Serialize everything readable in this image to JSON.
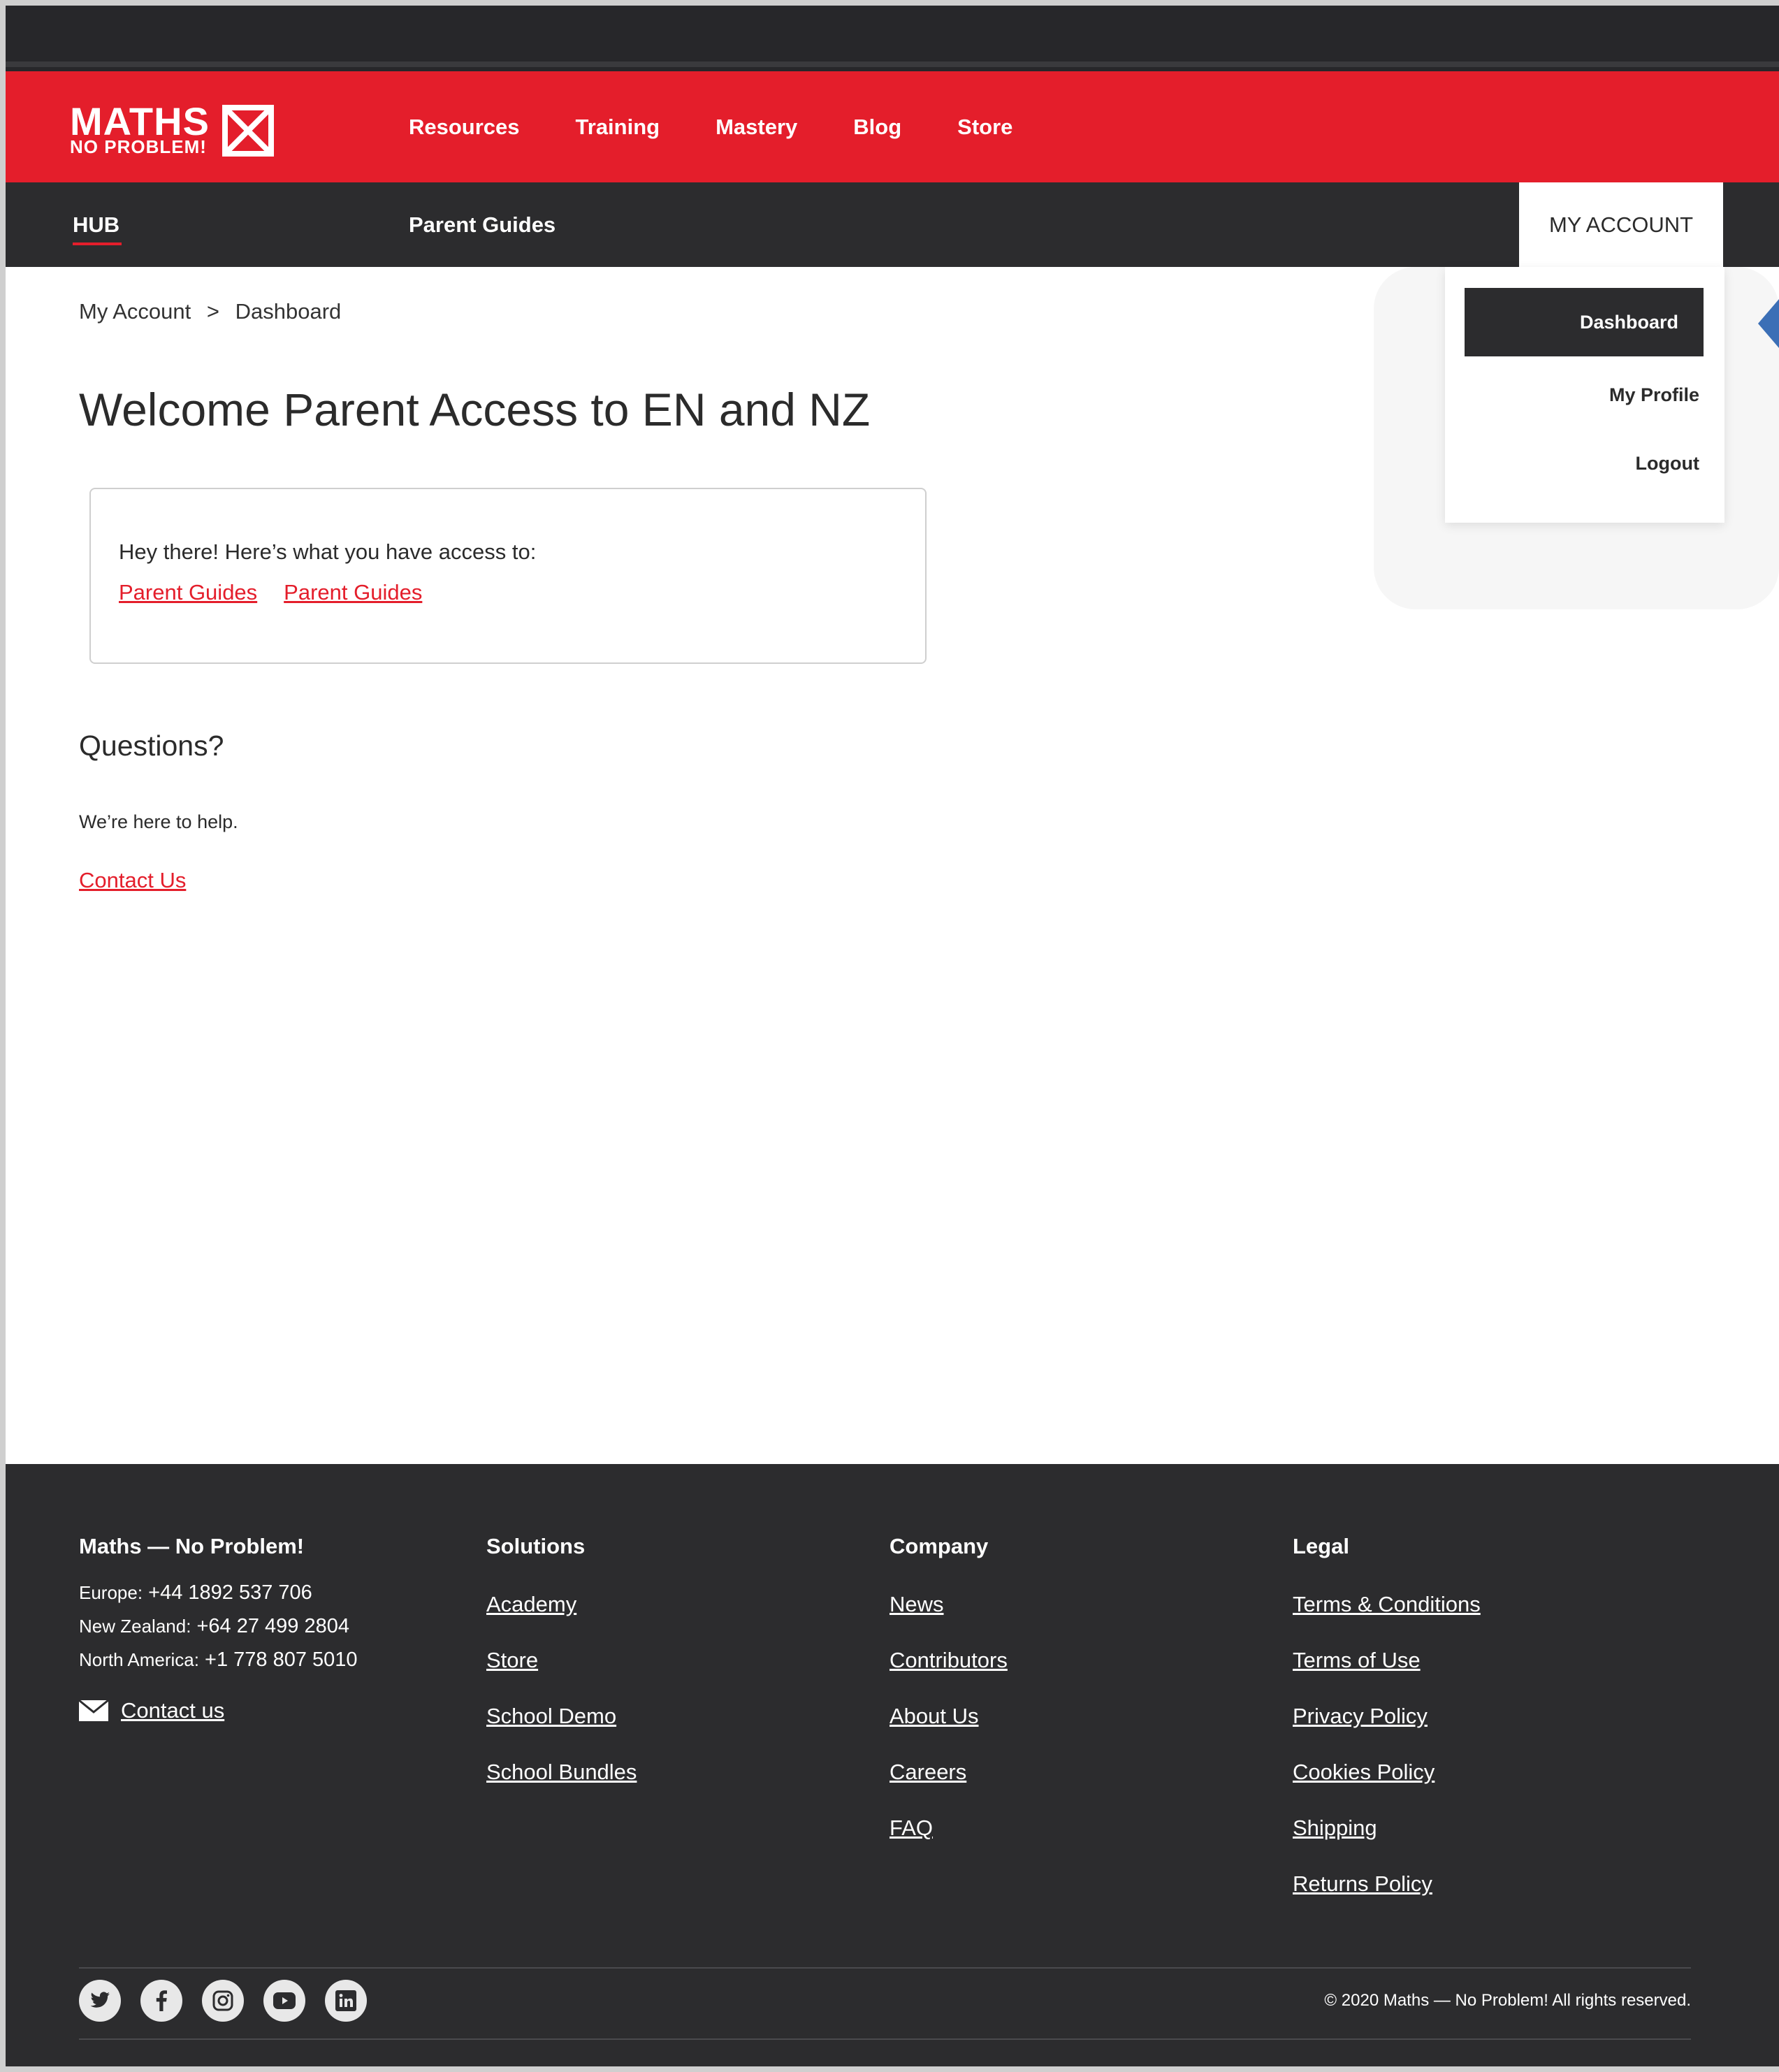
{
  "brand": {
    "logo_top": "MATHS",
    "logo_bottom": "NO PROBLEM!",
    "red": "#e41e2b",
    "dark": "#2c2c2e"
  },
  "main_nav": {
    "items": [
      {
        "label": "Resources"
      },
      {
        "label": "Training"
      },
      {
        "label": "Mastery"
      },
      {
        "label": "Blog"
      },
      {
        "label": "Store"
      }
    ]
  },
  "sub_nav": {
    "hub": "HUB",
    "parent_guides": "Parent Guides",
    "my_account": "MY ACCOUNT"
  },
  "account_menu": {
    "items": [
      {
        "label": "Dashboard",
        "active": true
      },
      {
        "label": "My Profile",
        "active": false
      },
      {
        "label": "Logout",
        "active": false
      }
    ]
  },
  "breadcrumb": {
    "root": "My Account",
    "separator": ">",
    "current": "Dashboard"
  },
  "main": {
    "title": "Welcome Parent Access to EN and NZ",
    "access_intro": "Hey there! Here’s what you have access to:",
    "access_links": [
      "Parent Guides",
      "Parent Guides"
    ],
    "questions_title": "Questions?",
    "questions_text": "We’re here to help.",
    "contact_link": "Contact Us"
  },
  "footer": {
    "company_col": {
      "heading": "Maths — No Problem!",
      "phones": [
        {
          "label": "Europe:",
          "number": "+44 1892 537 706"
        },
        {
          "label": "New Zealand:",
          "number": "+64 27 499 2804"
        },
        {
          "label": "North America:",
          "number": "+1 778 807 5010"
        }
      ],
      "contact": "Contact us"
    },
    "solutions": {
      "heading": "Solutions",
      "links": [
        "Academy",
        "Store",
        "School Demo",
        "School Bundles"
      ]
    },
    "company": {
      "heading": "Company",
      "links": [
        "News",
        "Contributors",
        "About Us",
        "Careers",
        "FAQ"
      ]
    },
    "legal": {
      "heading": "Legal",
      "links": [
        "Terms & Conditions",
        "Terms of Use",
        "Privacy Policy",
        "Cookies Policy",
        "Shipping",
        "Returns Policy"
      ]
    },
    "social_icons": [
      "twitter-icon",
      "facebook-icon",
      "instagram-icon",
      "youtube-icon",
      "linkedin-icon"
    ],
    "copyright": "© 2020 Maths — No Problem! All rights reserved."
  }
}
